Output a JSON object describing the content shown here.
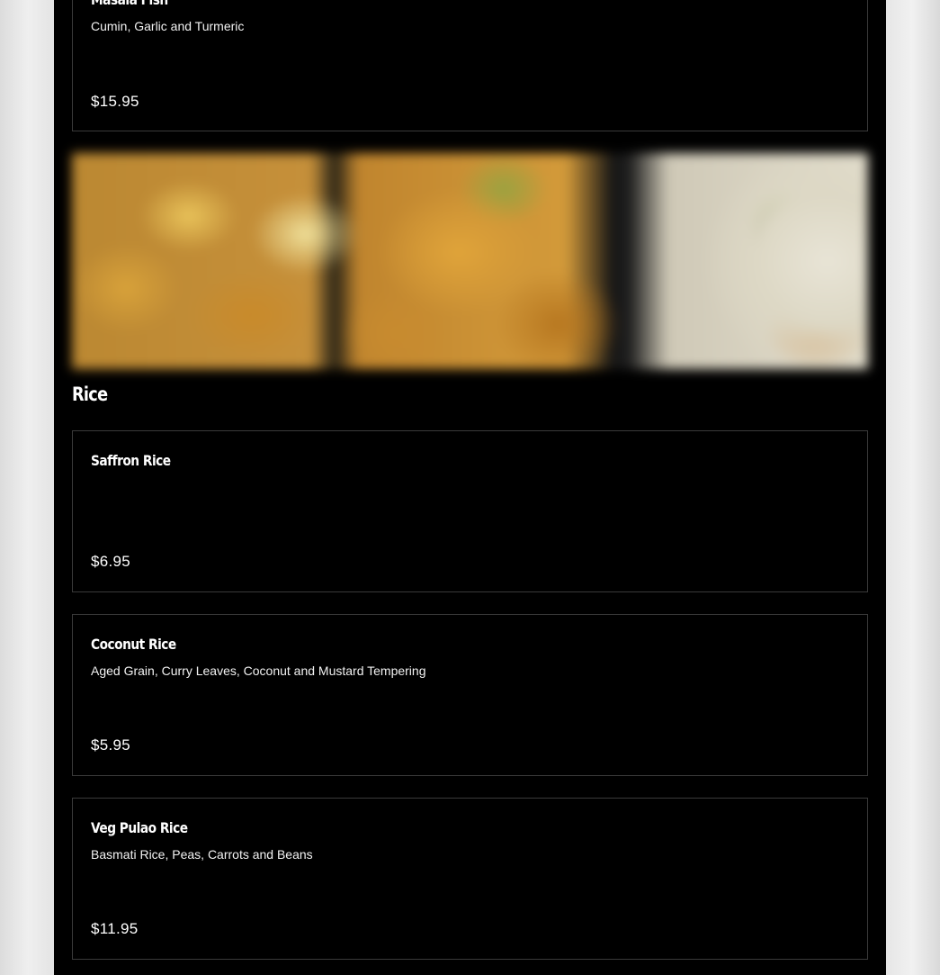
{
  "items_top": {
    "name": "Masala Fish",
    "description": "Cumin, Garlic and Turmeric",
    "price": "$15.95"
  },
  "section": {
    "title": "Rice"
  },
  "rice_items": [
    {
      "name": "Saffron Rice",
      "description": "",
      "price": "$6.95"
    },
    {
      "name": "Coconut Rice",
      "description": "Aged Grain, Curry Leaves, Coconut and Mustard Tempering",
      "price": "$5.95"
    },
    {
      "name": "Veg Pulao Rice",
      "description": "Basmati Rice, Peas, Carrots and Beans",
      "price": "$11.95"
    }
  ]
}
